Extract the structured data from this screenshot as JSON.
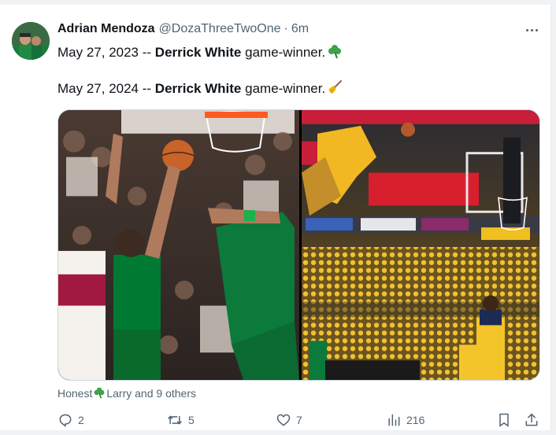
{
  "tweet": {
    "author_name": "Adrian Mendoza",
    "handle": "@DozaThreeTwoOne",
    "separator": "·",
    "time": "6m",
    "line1": {
      "date": "May 27, 2023 --",
      "player": "Derrick White",
      "rest": "game-winner."
    },
    "line2": {
      "date": "May 27, 2024 --",
      "player": "Derrick White",
      "rest": "game-winner."
    },
    "media": [
      {
        "description_icon": "photo-icon"
      },
      {
        "description_icon": "photo-icon"
      }
    ],
    "liked_by": {
      "first": "Honest",
      "second": "Larry and 9 others"
    }
  },
  "actions": {
    "reply_count": "2",
    "retweet_count": "5",
    "like_count": "7",
    "views_count": "216"
  },
  "colors": {
    "text": "#0f1419",
    "muted": "#536471",
    "celtics_green": "#007a33",
    "heat_red": "#98002e",
    "pacers_gold": "#fdbb30"
  }
}
